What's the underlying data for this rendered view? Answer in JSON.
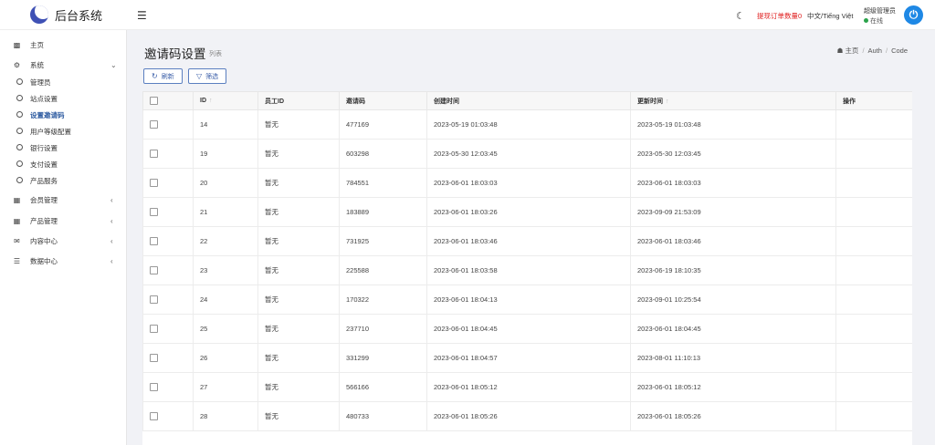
{
  "app": {
    "title": "后台系统"
  },
  "topbar": {
    "withdraw_label": "提现订单数量0",
    "language": "中文/Tiếng Việt",
    "user_name": "超级管理员",
    "user_status": "在线"
  },
  "sidebar": {
    "items": [
      {
        "label": "主页",
        "icon": "dashboard-icon"
      },
      {
        "label": "系统",
        "icon": "gear-icon"
      },
      {
        "label": "管理员",
        "icon": "circle-icon"
      },
      {
        "label": "站点设置",
        "icon": "circle-icon"
      },
      {
        "label": "设置邀请码",
        "icon": "circle-icon"
      },
      {
        "label": "用户等级配置",
        "icon": "circle-icon"
      },
      {
        "label": "银行设置",
        "icon": "circle-icon"
      },
      {
        "label": "支付设置",
        "icon": "circle-icon"
      },
      {
        "label": "产品服务",
        "icon": "circle-icon"
      },
      {
        "label": "会员管理",
        "icon": "id-card-icon"
      },
      {
        "label": "产品管理",
        "icon": "grid-icon"
      },
      {
        "label": "内容中心",
        "icon": "chat-icon"
      },
      {
        "label": "数据中心",
        "icon": "database-icon"
      }
    ],
    "active": "设置邀请码"
  },
  "page": {
    "title": "邀请码设置",
    "subtitle": "列表",
    "breadcrumb": [
      "主页",
      "Auth",
      "Code"
    ]
  },
  "toolbar": {
    "refresh_label": "刷新",
    "filter_label": "筛选"
  },
  "table": {
    "columns": [
      "ID",
      "员工ID",
      "邀请码",
      "创建时间",
      "更新时间",
      "操作"
    ],
    "rows": [
      [
        "14",
        "暂无",
        "477169",
        "2023-05-19 01:03:48",
        "2023-05-19 01:03:48"
      ],
      [
        "19",
        "暂无",
        "603298",
        "2023-05-30 12:03:45",
        "2023-05-30 12:03:45"
      ],
      [
        "20",
        "暂无",
        "784551",
        "2023-06-01 18:03:03",
        "2023-06-01 18:03:03"
      ],
      [
        "21",
        "暂无",
        "183889",
        "2023-06-01 18:03:26",
        "2023-09-09 21:53:09"
      ],
      [
        "22",
        "暂无",
        "731925",
        "2023-06-01 18:03:46",
        "2023-06-01 18:03:46"
      ],
      [
        "23",
        "暂无",
        "225588",
        "2023-06-01 18:03:58",
        "2023-06-19 18:10:35"
      ],
      [
        "24",
        "暂无",
        "170322",
        "2023-06-01 18:04:13",
        "2023-09-01 10:25:54"
      ],
      [
        "25",
        "暂无",
        "237710",
        "2023-06-01 18:04:45",
        "2023-06-01 18:04:45"
      ],
      [
        "26",
        "暂无",
        "331299",
        "2023-06-01 18:04:57",
        "2023-08-01 11:10:13"
      ],
      [
        "27",
        "暂无",
        "566166",
        "2023-06-01 18:05:12",
        "2023-06-01 18:05:12"
      ],
      [
        "28",
        "暂无",
        "480733",
        "2023-06-01 18:05:26",
        "2023-06-01 18:05:26"
      ]
    ]
  }
}
